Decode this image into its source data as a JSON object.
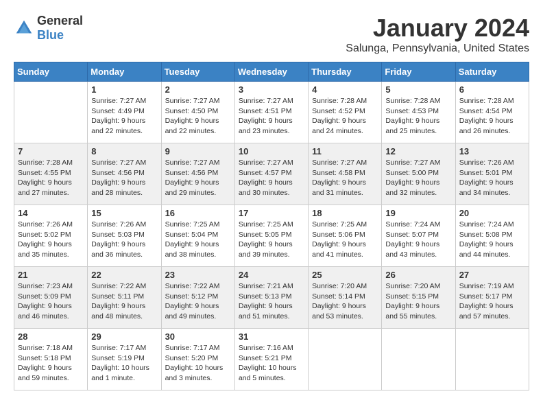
{
  "app": {
    "name_general": "General",
    "name_blue": "Blue"
  },
  "header": {
    "month_title": "January 2024",
    "subtitle": "Salunga, Pennsylvania, United States"
  },
  "days_of_week": [
    "Sunday",
    "Monday",
    "Tuesday",
    "Wednesday",
    "Thursday",
    "Friday",
    "Saturday"
  ],
  "weeks": [
    {
      "shaded": false,
      "days": [
        {
          "num": "",
          "info": ""
        },
        {
          "num": "1",
          "info": "Sunrise: 7:27 AM\nSunset: 4:49 PM\nDaylight: 9 hours\nand 22 minutes."
        },
        {
          "num": "2",
          "info": "Sunrise: 7:27 AM\nSunset: 4:50 PM\nDaylight: 9 hours\nand 22 minutes."
        },
        {
          "num": "3",
          "info": "Sunrise: 7:27 AM\nSunset: 4:51 PM\nDaylight: 9 hours\nand 23 minutes."
        },
        {
          "num": "4",
          "info": "Sunrise: 7:28 AM\nSunset: 4:52 PM\nDaylight: 9 hours\nand 24 minutes."
        },
        {
          "num": "5",
          "info": "Sunrise: 7:28 AM\nSunset: 4:53 PM\nDaylight: 9 hours\nand 25 minutes."
        },
        {
          "num": "6",
          "info": "Sunrise: 7:28 AM\nSunset: 4:54 PM\nDaylight: 9 hours\nand 26 minutes."
        }
      ]
    },
    {
      "shaded": true,
      "days": [
        {
          "num": "7",
          "info": "Sunrise: 7:28 AM\nSunset: 4:55 PM\nDaylight: 9 hours\nand 27 minutes."
        },
        {
          "num": "8",
          "info": "Sunrise: 7:27 AM\nSunset: 4:56 PM\nDaylight: 9 hours\nand 28 minutes."
        },
        {
          "num": "9",
          "info": "Sunrise: 7:27 AM\nSunset: 4:56 PM\nDaylight: 9 hours\nand 29 minutes."
        },
        {
          "num": "10",
          "info": "Sunrise: 7:27 AM\nSunset: 4:57 PM\nDaylight: 9 hours\nand 30 minutes."
        },
        {
          "num": "11",
          "info": "Sunrise: 7:27 AM\nSunset: 4:58 PM\nDaylight: 9 hours\nand 31 minutes."
        },
        {
          "num": "12",
          "info": "Sunrise: 7:27 AM\nSunset: 5:00 PM\nDaylight: 9 hours\nand 32 minutes."
        },
        {
          "num": "13",
          "info": "Sunrise: 7:26 AM\nSunset: 5:01 PM\nDaylight: 9 hours\nand 34 minutes."
        }
      ]
    },
    {
      "shaded": false,
      "days": [
        {
          "num": "14",
          "info": "Sunrise: 7:26 AM\nSunset: 5:02 PM\nDaylight: 9 hours\nand 35 minutes."
        },
        {
          "num": "15",
          "info": "Sunrise: 7:26 AM\nSunset: 5:03 PM\nDaylight: 9 hours\nand 36 minutes."
        },
        {
          "num": "16",
          "info": "Sunrise: 7:25 AM\nSunset: 5:04 PM\nDaylight: 9 hours\nand 38 minutes."
        },
        {
          "num": "17",
          "info": "Sunrise: 7:25 AM\nSunset: 5:05 PM\nDaylight: 9 hours\nand 39 minutes."
        },
        {
          "num": "18",
          "info": "Sunrise: 7:25 AM\nSunset: 5:06 PM\nDaylight: 9 hours\nand 41 minutes."
        },
        {
          "num": "19",
          "info": "Sunrise: 7:24 AM\nSunset: 5:07 PM\nDaylight: 9 hours\nand 43 minutes."
        },
        {
          "num": "20",
          "info": "Sunrise: 7:24 AM\nSunset: 5:08 PM\nDaylight: 9 hours\nand 44 minutes."
        }
      ]
    },
    {
      "shaded": true,
      "days": [
        {
          "num": "21",
          "info": "Sunrise: 7:23 AM\nSunset: 5:09 PM\nDaylight: 9 hours\nand 46 minutes."
        },
        {
          "num": "22",
          "info": "Sunrise: 7:22 AM\nSunset: 5:11 PM\nDaylight: 9 hours\nand 48 minutes."
        },
        {
          "num": "23",
          "info": "Sunrise: 7:22 AM\nSunset: 5:12 PM\nDaylight: 9 hours\nand 49 minutes."
        },
        {
          "num": "24",
          "info": "Sunrise: 7:21 AM\nSunset: 5:13 PM\nDaylight: 9 hours\nand 51 minutes."
        },
        {
          "num": "25",
          "info": "Sunrise: 7:20 AM\nSunset: 5:14 PM\nDaylight: 9 hours\nand 53 minutes."
        },
        {
          "num": "26",
          "info": "Sunrise: 7:20 AM\nSunset: 5:15 PM\nDaylight: 9 hours\nand 55 minutes."
        },
        {
          "num": "27",
          "info": "Sunrise: 7:19 AM\nSunset: 5:17 PM\nDaylight: 9 hours\nand 57 minutes."
        }
      ]
    },
    {
      "shaded": false,
      "days": [
        {
          "num": "28",
          "info": "Sunrise: 7:18 AM\nSunset: 5:18 PM\nDaylight: 9 hours\nand 59 minutes."
        },
        {
          "num": "29",
          "info": "Sunrise: 7:17 AM\nSunset: 5:19 PM\nDaylight: 10 hours\nand 1 minute."
        },
        {
          "num": "30",
          "info": "Sunrise: 7:17 AM\nSunset: 5:20 PM\nDaylight: 10 hours\nand 3 minutes."
        },
        {
          "num": "31",
          "info": "Sunrise: 7:16 AM\nSunset: 5:21 PM\nDaylight: 10 hours\nand 5 minutes."
        },
        {
          "num": "",
          "info": ""
        },
        {
          "num": "",
          "info": ""
        },
        {
          "num": "",
          "info": ""
        }
      ]
    }
  ]
}
